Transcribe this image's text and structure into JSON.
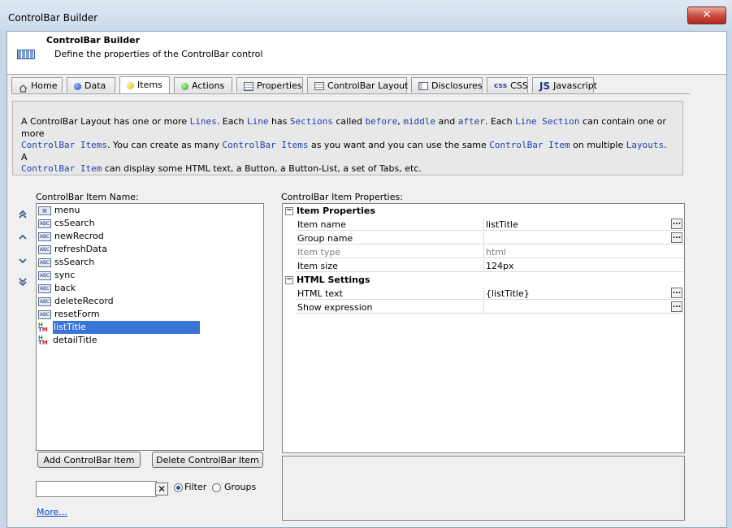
{
  "window": {
    "title": "ControlBar Builder",
    "close_label": "✕"
  },
  "header": {
    "title": "ControlBar Builder",
    "subtitle": "Define the properties of the ControlBar control"
  },
  "tabs": [
    {
      "label": "Home",
      "icon": "home-icon"
    },
    {
      "label": "Data",
      "icon": "blue-dot-icon"
    },
    {
      "label": "Items",
      "icon": "yellow-dot-icon",
      "active": true
    },
    {
      "label": "Actions",
      "icon": "green-dot-icon"
    },
    {
      "label": "Properties",
      "icon": "properties-icon"
    },
    {
      "label": "ControlBar Layout",
      "icon": "layout-icon"
    },
    {
      "label": "Disclosures",
      "icon": "disclosures-icon"
    },
    {
      "label": "CSS",
      "icon": "css-icon",
      "icon_text": "css"
    },
    {
      "label": "Javascript",
      "icon": "js-icon",
      "icon_text": "JS"
    }
  ],
  "info": {
    "l1a": "A ControlBar Layout has one or more ",
    "l1b": "Lines",
    "l1c": ". Each ",
    "l1d": "Line",
    "l1e": " has ",
    "l1f": "Sections",
    "l1g": " called ",
    "l1h": "before",
    "l1i": ", ",
    "l1j": "middle",
    "l1k": " and ",
    "l1l": "after",
    "l1m": ". Each ",
    "l1n": "Line Section",
    "l1o": " can contain one or more",
    "l2a": "ControlBar Items",
    "l2b": ". You can create as many ",
    "l2c": "ControlBar Items",
    "l2d": " as you want and you can use the same ",
    "l2e": "ControlBar Item",
    "l2f": " on multiple ",
    "l2g": "Layouts",
    "l2h": ". A",
    "l3a": "ControlBar Item",
    "l3b": " can display some HTML text, a Button, a Button-List, a set of Tabs, etc."
  },
  "items_panel": {
    "label": "ControlBar Item Name:",
    "items": [
      {
        "name": "menu",
        "type": "menu"
      },
      {
        "name": "csSearch",
        "type": "abc"
      },
      {
        "name": "newRecrod",
        "type": "abc"
      },
      {
        "name": "refreshData",
        "type": "abc"
      },
      {
        "name": "ssSearch",
        "type": "abc"
      },
      {
        "name": "sync",
        "type": "abc"
      },
      {
        "name": "back",
        "type": "abc"
      },
      {
        "name": "deleteRecord",
        "type": "abc"
      },
      {
        "name": "resetForm",
        "type": "abc"
      },
      {
        "name": "listTitle",
        "type": "html",
        "selected": true
      },
      {
        "name": "detailTitle",
        "type": "html"
      }
    ],
    "add_button": "Add ControlBar Item",
    "delete_button": "Delete ControlBar Item",
    "filter_value": "",
    "filter_label": "Filter",
    "groups_label": "Groups",
    "filter_mode": "Filter",
    "more_link": "More..."
  },
  "properties_panel": {
    "label": "ControlBar Item Properties:",
    "categories": [
      {
        "title": "Item Properties",
        "rows": [
          {
            "name": "Item name",
            "value": "listTitle",
            "ellipsis": true
          },
          {
            "name": "Group name",
            "value": "",
            "ellipsis": true
          },
          {
            "name": "Item type",
            "value": "html",
            "disabled": true
          },
          {
            "name": "Item size",
            "value": "124px"
          }
        ]
      },
      {
        "title": "HTML Settings",
        "rows": [
          {
            "name": "HTML text",
            "value": "{listTitle}",
            "ellipsis": true
          },
          {
            "name": "Show expression",
            "value": "",
            "ellipsis": true
          }
        ]
      }
    ]
  },
  "colors": {
    "selection": "#3875d7",
    "code": "#1e3fae",
    "link": "#0b3fd6"
  }
}
